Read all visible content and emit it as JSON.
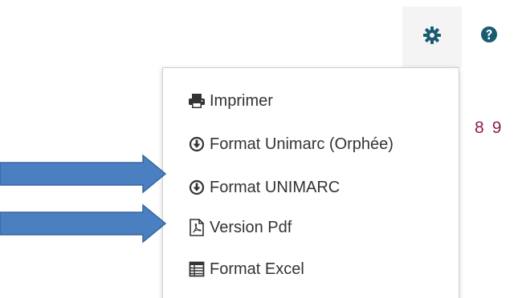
{
  "toolbar": {
    "settings_icon": "gear-icon",
    "help_icon": "question-circle-icon",
    "accent_color": "#1a5b72"
  },
  "pagination": {
    "pages": [
      "8",
      "9"
    ],
    "color": "#8c1d55"
  },
  "dropdown": {
    "items": [
      {
        "label": "Imprimer",
        "icon": "printer-icon"
      },
      {
        "label": "Format Unimarc (Orphée)",
        "icon": "download-circle-icon"
      },
      {
        "label": "Format UNIMARC",
        "icon": "download-circle-icon"
      },
      {
        "label": "Version Pdf",
        "icon": "pdf-file-icon"
      },
      {
        "label": "Format Excel",
        "icon": "spreadsheet-icon"
      }
    ]
  },
  "annotations": {
    "arrow_color": "#4a7fc1",
    "arrow_targets": [
      "Format UNIMARC",
      "Version Pdf"
    ]
  }
}
